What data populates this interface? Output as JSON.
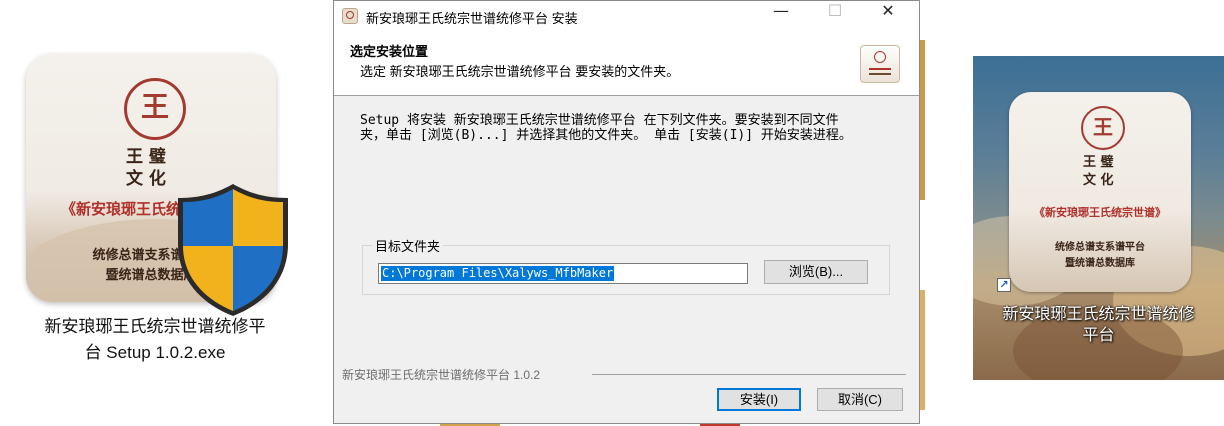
{
  "installer_icon": {
    "seal_char": "王",
    "vertical_text": [
      "王 璧",
      "文 化"
    ],
    "subtitle": "《新安琅琊王氏统宗世谱》",
    "lines": [
      "统修总谱支系谱平台",
      "暨统谱总数据库"
    ],
    "label_line1": "新安琅琊王氏统宗世谱统修平",
    "label_line2": "台 Setup 1.0.2.exe",
    "shield_icon": "uac-shield-icon"
  },
  "dialog": {
    "title": "新安琅琊王氏统宗世谱统修平台 安装",
    "window_controls": {
      "minimize": "—",
      "maximize": "☐",
      "close": "✕"
    },
    "header_title": "选定安装位置",
    "header_subtitle": "选定 新安琅琊王氏统宗世谱统修平台 要安装的文件夹。",
    "body_line1": "Setup 将安装 新安琅琊王氏统宗世谱统修平台 在下列文件夹。要安装到不同文件",
    "body_line2": "夹，单击 [浏览(B)...] 并选择其他的文件夹。 单击 [安装(I)] 开始安装进程。",
    "group_label": "目标文件夹",
    "install_path": "C:\\Program Files\\Xalyws_MfbMaker",
    "browse_label": "浏览(B)...",
    "footer_brand": "新安琅琊王氏统宗世谱统修平台 1.0.2",
    "install_label": "安装(I)",
    "cancel_label": "取消(C)"
  },
  "desktop_shortcut": {
    "seal_char": "王",
    "vertical_text": [
      "王 璧",
      "文 化"
    ],
    "subtitle": "《新安琅琊王氏统宗世谱》",
    "lines": [
      "统修总谱支系谱平台",
      "暨统谱总数据库"
    ],
    "shortcut_arrow": "↗",
    "label_line1": "新安琅琊王氏统宗世谱统修",
    "label_line2": "平台"
  },
  "colors": {
    "accent": "#0078d7",
    "seal_red": "#a33a30"
  }
}
